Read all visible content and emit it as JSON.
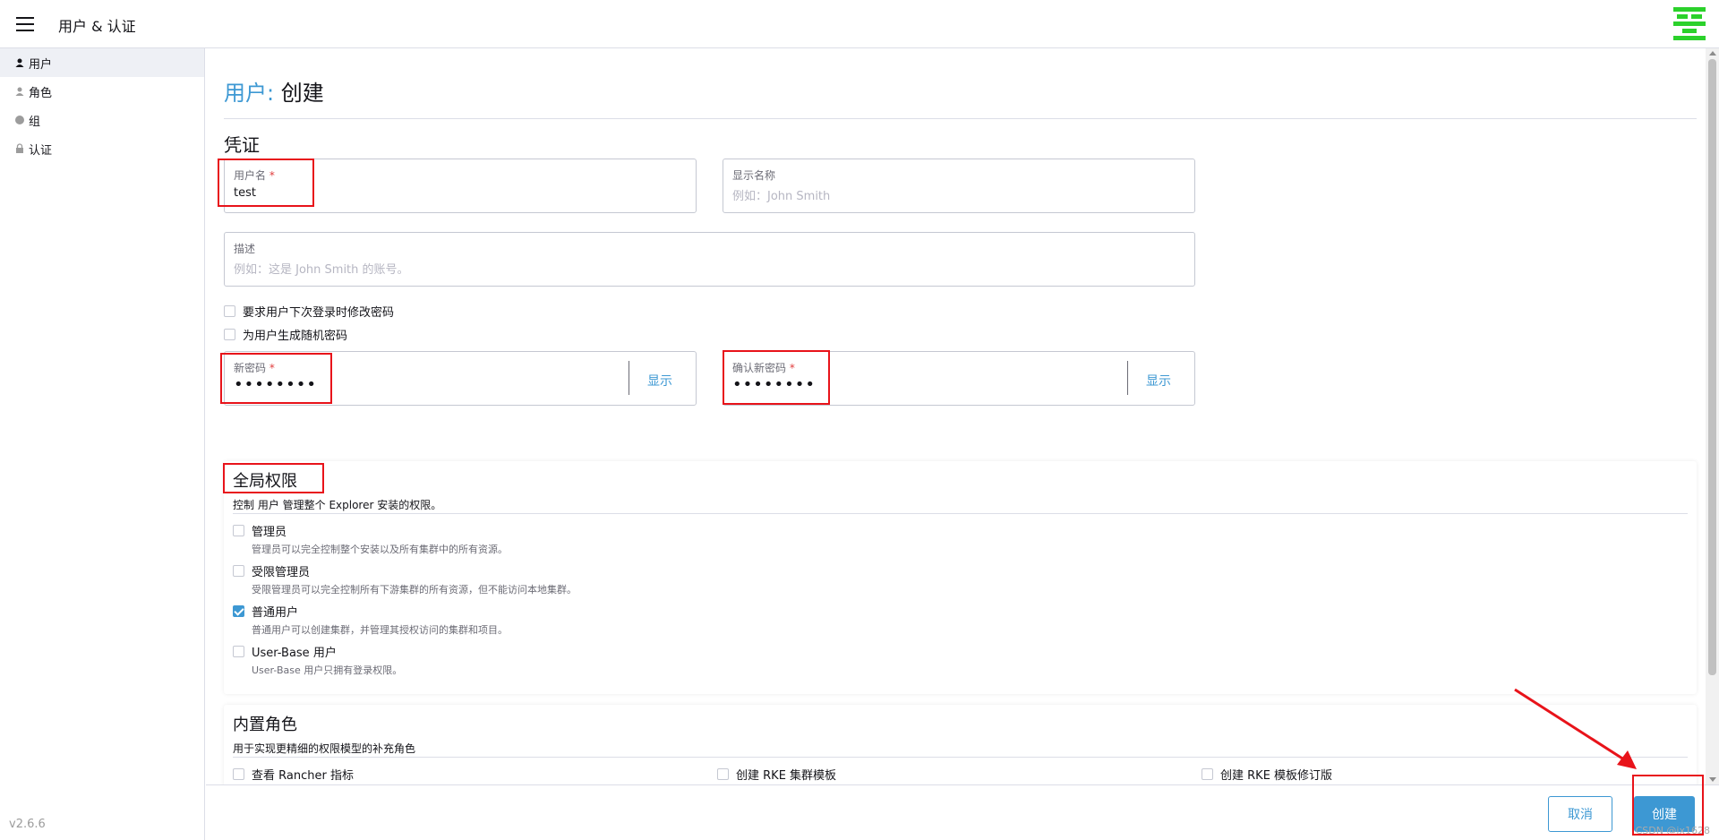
{
  "header": {
    "title": "用户 & 认证",
    "menu_icon": "hamburger-icon",
    "logo_icon": "rancher-logo"
  },
  "sidebar": {
    "items": [
      {
        "label": "用户",
        "icon": "user-icon",
        "active": true
      },
      {
        "label": "角色",
        "icon": "role-icon",
        "active": false
      },
      {
        "label": "组",
        "icon": "group-icon",
        "active": false
      },
      {
        "label": "认证",
        "icon": "lock-icon",
        "active": false
      }
    ],
    "version": "v2.6.6"
  },
  "page": {
    "crumb": "用户:",
    "title": "创建"
  },
  "credentials": {
    "heading": "凭证",
    "username": {
      "label": "用户名",
      "required": "*",
      "value": "test"
    },
    "display_name": {
      "label": "显示名称",
      "placeholder": "例如：John Smith"
    },
    "description": {
      "label": "描述",
      "placeholder": "例如：这是 John Smith 的账号。"
    },
    "require_change": {
      "label": "要求用户下次登录时修改密码",
      "checked": false
    },
    "random_password": {
      "label": "为用户生成随机密码",
      "checked": false
    },
    "new_password": {
      "label": "新密码",
      "required": "*",
      "value": "••••••••",
      "show": "显示"
    },
    "confirm_password": {
      "label": "确认新密码",
      "required": "*",
      "value": "••••••••",
      "show": "显示"
    }
  },
  "global_permissions": {
    "heading": "全局权限",
    "desc": "控制 用户 管理整个 Explorer 安装的权限。",
    "options": [
      {
        "label": "管理员",
        "sub": "管理员可以完全控制整个安装以及所有集群中的所有资源。",
        "checked": false
      },
      {
        "label": "受限管理员",
        "sub": "受限管理员可以完全控制所有下游集群的所有资源，但不能访问本地集群。",
        "checked": false
      },
      {
        "label": "普通用户",
        "sub": "普通用户可以创建集群，并管理其授权访问的集群和项目。",
        "checked": true
      },
      {
        "label": "User-Base 用户",
        "sub": "User-Base 用户只拥有登录权限。",
        "checked": false
      }
    ]
  },
  "builtin_roles": {
    "heading": "内置角色",
    "desc": "用于实现更精细的权限模型的补充角色",
    "options": [
      {
        "label": "查看 Rancher 指标",
        "checked": false
      },
      {
        "label": "创建 RKE 集群模板",
        "checked": false
      },
      {
        "label": "创建 RKE 模板修订版",
        "checked": false
      }
    ]
  },
  "footer": {
    "cancel": "取消",
    "create": "创建",
    "watermark": "CSDN @jx1628"
  },
  "colors": {
    "accent": "#3d98d3",
    "highlight": "#e8131a",
    "logo": "#2bd12b"
  }
}
